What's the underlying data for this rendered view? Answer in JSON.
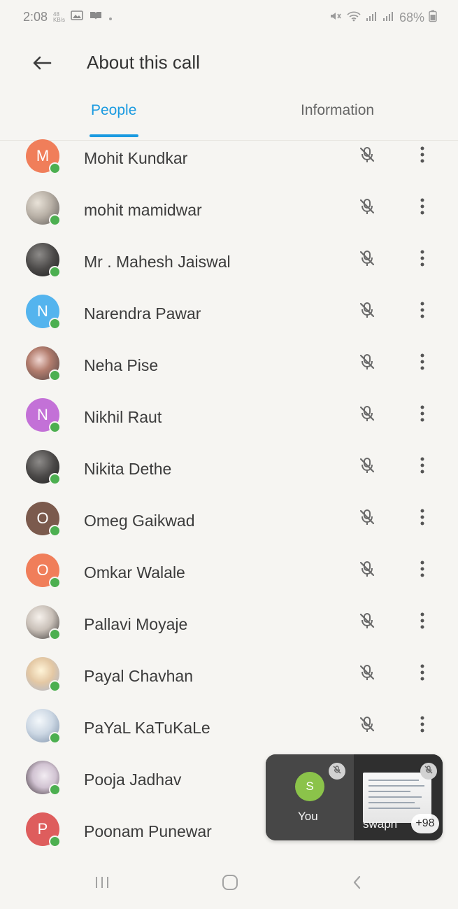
{
  "status_bar": {
    "time": "2:08",
    "data_rate_value": "48",
    "data_rate_unit": "KB/s",
    "battery": "68%"
  },
  "header": {
    "title": "About this call"
  },
  "tabs": [
    {
      "label": "People"
    },
    {
      "label": "Information"
    }
  ],
  "people": [
    {
      "name": "Mohit Kundkar",
      "avatar_letter": "M",
      "avatar_color": "#f07e5a"
    },
    {
      "name": "mohit mamidwar",
      "avatar_letter": "",
      "avatar_color": ""
    },
    {
      "name": "Mr . Mahesh Jaiswal",
      "avatar_letter": "",
      "avatar_color": ""
    },
    {
      "name": "Narendra Pawar",
      "avatar_letter": "N",
      "avatar_color": "#54b4ee"
    },
    {
      "name": "Neha Pise",
      "avatar_letter": "",
      "avatar_color": ""
    },
    {
      "name": "Nikhil Raut",
      "avatar_letter": "N",
      "avatar_color": "#c371d7"
    },
    {
      "name": "Nikita Dethe",
      "avatar_letter": "",
      "avatar_color": ""
    },
    {
      "name": "Omeg Gaikwad",
      "avatar_letter": "O",
      "avatar_color": "#7b5a4d"
    },
    {
      "name": "Omkar Walale",
      "avatar_letter": "O",
      "avatar_color": "#f07e5a"
    },
    {
      "name": "Pallavi Moyaje",
      "avatar_letter": "",
      "avatar_color": ""
    },
    {
      "name": "Payal Chavhan",
      "avatar_letter": "",
      "avatar_color": ""
    },
    {
      "name": "PaYaL KaTuKaLe",
      "avatar_letter": "",
      "avatar_color": ""
    },
    {
      "name": "Pooja Jadhav",
      "avatar_letter": "",
      "avatar_color": ""
    },
    {
      "name": "Poonam Punewar",
      "avatar_letter": "P",
      "avatar_color": "#de5d5d"
    }
  ],
  "pip": {
    "self_letter": "S",
    "self_label": "You",
    "other_label": "swapn",
    "count_label": "+98"
  },
  "icons": {
    "back": "back-arrow-icon",
    "mic_off": "mic-off-icon",
    "more": "more-vert-icon",
    "nav_recent": "recent-apps-icon",
    "nav_home": "home-icon",
    "nav_back": "back-icon"
  },
  "colors": {
    "accent": "#1a9ae0",
    "presence_online": "#4caf50"
  }
}
